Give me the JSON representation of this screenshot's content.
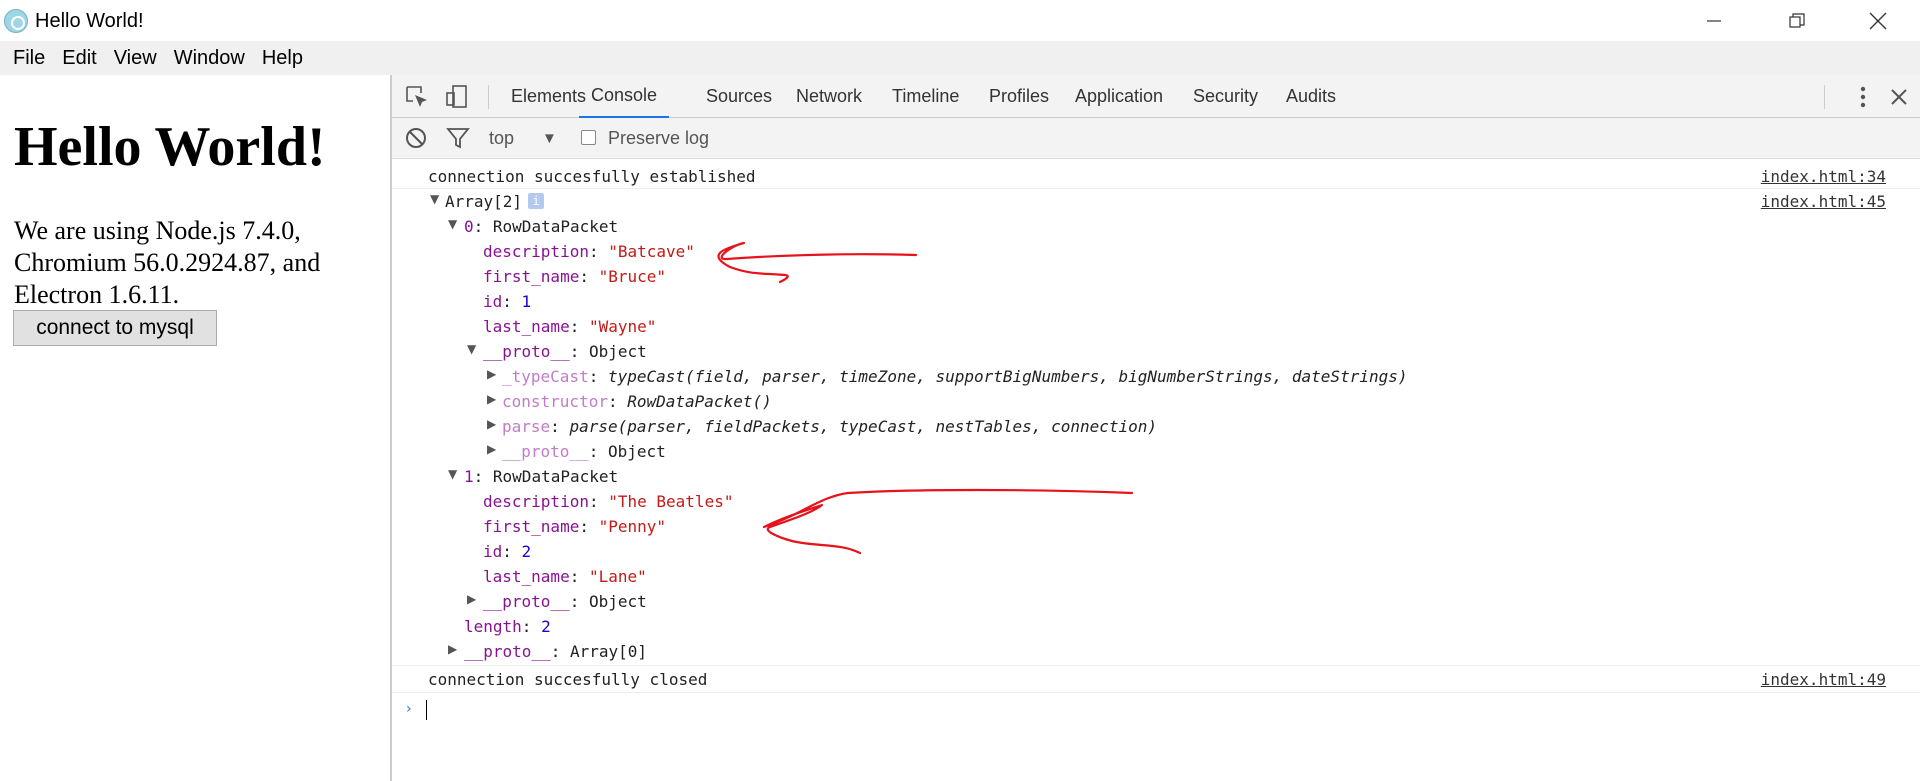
{
  "window": {
    "title": "Hello World!",
    "controls": [
      "minimize",
      "restore",
      "close"
    ]
  },
  "menu": [
    "File",
    "Edit",
    "View",
    "Window",
    "Help"
  ],
  "page": {
    "heading": "Hello World!",
    "paragraph": "We are using Node.js 7.4.0, Chromium 56.0.2924.87, and Electron 1.6.11.",
    "button": "connect to mysql"
  },
  "devtools": {
    "tabs": [
      "Elements",
      "Console",
      "Sources",
      "Network",
      "Timeline",
      "Profiles",
      "Application",
      "Security",
      "Audits"
    ],
    "active_tab": "Console",
    "toolbar": {
      "context": "top",
      "preserve_log": "Preserve log"
    }
  },
  "console": {
    "msg1": {
      "text": "connection succesfully established",
      "source": "index.html:34"
    },
    "msg2": {
      "label": "Array[2]",
      "badge": "i",
      "source": "index.html:45"
    },
    "row0": {
      "header_key": "0",
      "header_val": ": RowDataPacket"
    },
    "row0_desc": {
      "key": "description",
      "val": "\"Batcave\""
    },
    "row0_first": {
      "key": "first_name",
      "val": "\"Bruce\""
    },
    "row0_id": {
      "key": "id",
      "val": "1"
    },
    "row0_last": {
      "key": "last_name",
      "val": "\"Wayne\""
    },
    "row0_proto": {
      "key": "__proto__",
      "val": ": Object"
    },
    "typecast": {
      "key": "_typeCast",
      "val": "typeCast(field, parser, timeZone, supportBigNumbers, bigNumberStrings, dateStrings)"
    },
    "constructor": {
      "key": "constructor",
      "val": "RowDataPacket()"
    },
    "parse": {
      "key": "parse",
      "val": "parse(parser, fieldPackets, typeCast, nestTables, connection)"
    },
    "inner_proto": {
      "key": "__proto__",
      "val": ": Object"
    },
    "row1": {
      "header_key": "1",
      "header_val": ": RowDataPacket"
    },
    "row1_desc": {
      "key": "description",
      "val": "\"The Beatles\""
    },
    "row1_first": {
      "key": "first_name",
      "val": "\"Penny\""
    },
    "row1_id": {
      "key": "id",
      "val": "2"
    },
    "row1_last": {
      "key": "last_name",
      "val": "\"Lane\""
    },
    "row1_proto": {
      "key": "__proto__",
      "val": ": Object"
    },
    "length": {
      "key": "length",
      "val": "2"
    },
    "array_proto": {
      "key": "__proto__",
      "val": ": Array[0]"
    },
    "msg3": {
      "text": "connection succesfully closed",
      "source": "index.html:49"
    },
    "colon": ": "
  },
  "colors": {
    "accent": "#1a73e8",
    "annotation": "#e8121b",
    "key": "#881391",
    "string": "#c41a16",
    "number": "#1c00cf"
  }
}
